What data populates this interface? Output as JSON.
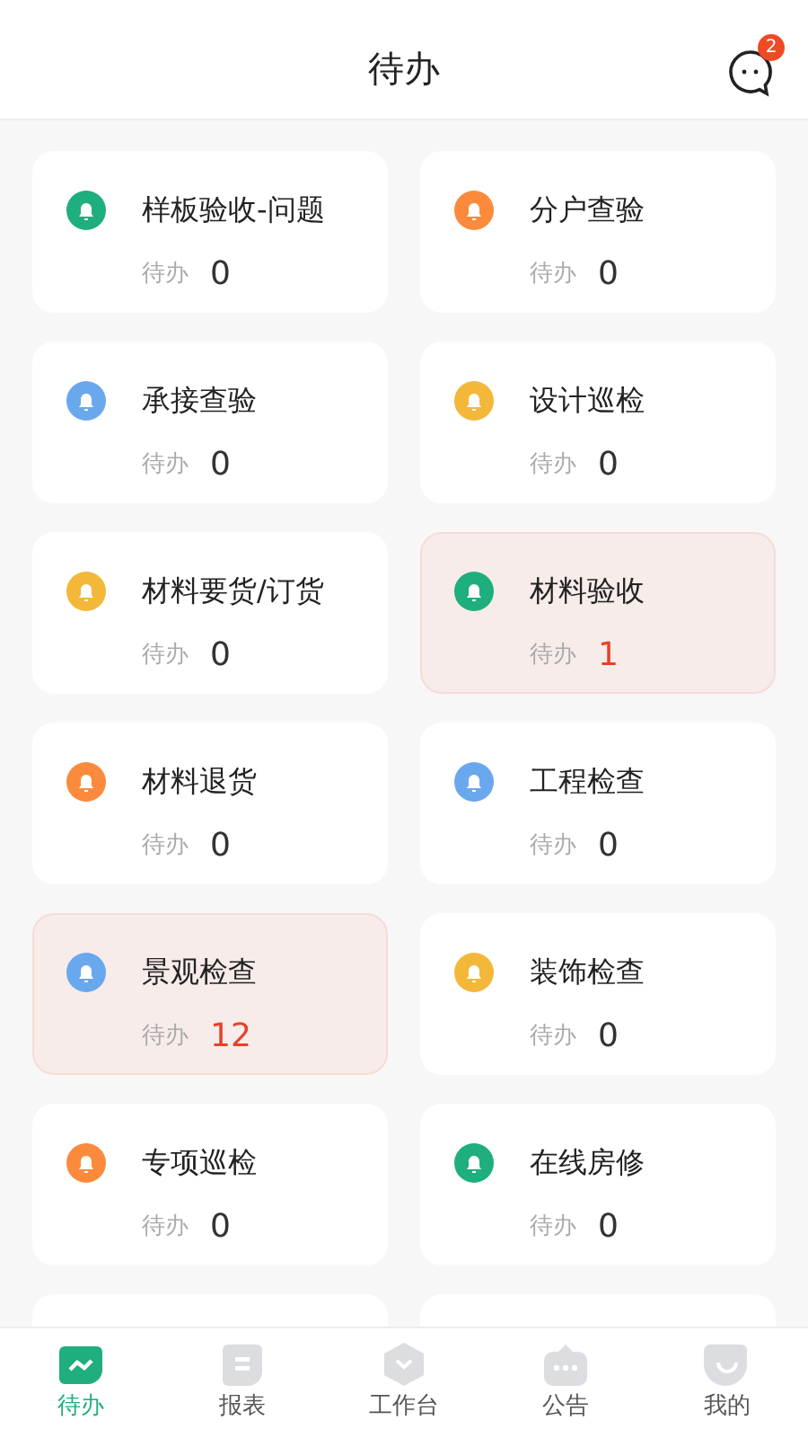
{
  "header": {
    "title": "待办",
    "message_badge": "2"
  },
  "cards": [
    {
      "title": "样板验收-问题",
      "label": "待办",
      "count": "0",
      "color": "#1fae7e",
      "highlighted": false
    },
    {
      "title": "分户查验",
      "label": "待办",
      "count": "0",
      "color": "#fb8a3c",
      "highlighted": false
    },
    {
      "title": "承接查验",
      "label": "待办",
      "count": "0",
      "color": "#6aa8ee",
      "highlighted": false
    },
    {
      "title": "设计巡检",
      "label": "待办",
      "count": "0",
      "color": "#f3b73a",
      "highlighted": false
    },
    {
      "title": "材料要货/订货",
      "label": "待办",
      "count": "0",
      "color": "#f3b73a",
      "highlighted": false
    },
    {
      "title": "材料验收",
      "label": "待办",
      "count": "1",
      "color": "#1fae7e",
      "highlighted": true
    },
    {
      "title": "材料退货",
      "label": "待办",
      "count": "0",
      "color": "#fb8a3c",
      "highlighted": false
    },
    {
      "title": "工程检查",
      "label": "待办",
      "count": "0",
      "color": "#6aa8ee",
      "highlighted": false
    },
    {
      "title": "景观检查",
      "label": "待办",
      "count": "12",
      "color": "#6aa8ee",
      "highlighted": true
    },
    {
      "title": "装饰检查",
      "label": "待办",
      "count": "0",
      "color": "#f3b73a",
      "highlighted": false
    },
    {
      "title": "专项巡检",
      "label": "待办",
      "count": "0",
      "color": "#fb8a3c",
      "highlighted": false
    },
    {
      "title": "在线房修",
      "label": "待办",
      "count": "0",
      "color": "#1fae7e",
      "highlighted": false
    }
  ],
  "tab_bar": [
    {
      "label": "待办",
      "selected": true
    },
    {
      "label": "报表",
      "selected": false
    },
    {
      "label": "工作台",
      "selected": false
    },
    {
      "label": "公告",
      "selected": false
    },
    {
      "label": "我的",
      "selected": false
    }
  ]
}
